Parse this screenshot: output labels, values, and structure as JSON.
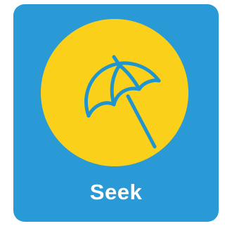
{
  "tile": {
    "label": "Seek",
    "icon": "beach-umbrella-icon",
    "colors": {
      "background": "#2a9ad6",
      "circle": "#fad01a",
      "icon_stroke": "#1f95cf",
      "label": "#ffffff"
    }
  }
}
